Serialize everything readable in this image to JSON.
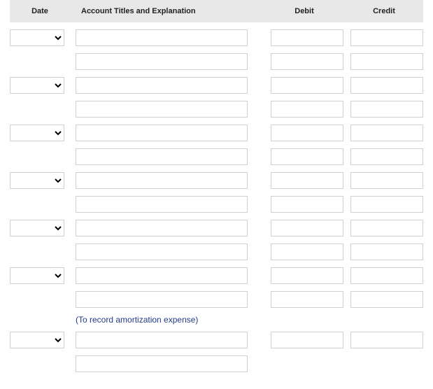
{
  "headers": {
    "date": "Date",
    "account": "Account Titles and Explanation",
    "debit": "Debit",
    "credit": "Credit"
  },
  "entries": [
    {
      "date": "",
      "lines": [
        {
          "account": "",
          "debit": "",
          "credit": ""
        },
        {
          "account": "",
          "debit": "",
          "credit": ""
        }
      ],
      "caption": ""
    },
    {
      "date": "",
      "lines": [
        {
          "account": "",
          "debit": "",
          "credit": ""
        },
        {
          "account": "",
          "debit": "",
          "credit": ""
        }
      ],
      "caption": ""
    },
    {
      "date": "",
      "lines": [
        {
          "account": "",
          "debit": "",
          "credit": ""
        },
        {
          "account": "",
          "debit": "",
          "credit": ""
        }
      ],
      "caption": ""
    },
    {
      "date": "",
      "lines": [
        {
          "account": "",
          "debit": "",
          "credit": ""
        },
        {
          "account": "",
          "debit": "",
          "credit": ""
        }
      ],
      "caption": ""
    },
    {
      "date": "",
      "lines": [
        {
          "account": "",
          "debit": "",
          "credit": ""
        },
        {
          "account": "",
          "debit": "",
          "credit": ""
        }
      ],
      "caption": ""
    },
    {
      "date": "",
      "lines": [
        {
          "account": "",
          "debit": "",
          "credit": ""
        },
        {
          "account": "",
          "debit": "",
          "credit": ""
        }
      ],
      "caption": "(To record amortization expense)"
    },
    {
      "date": "",
      "lines": [
        {
          "account": "",
          "debit": "",
          "credit": ""
        },
        {
          "account": "",
          "debit": "",
          "credit": ""
        }
      ],
      "caption": ""
    }
  ]
}
